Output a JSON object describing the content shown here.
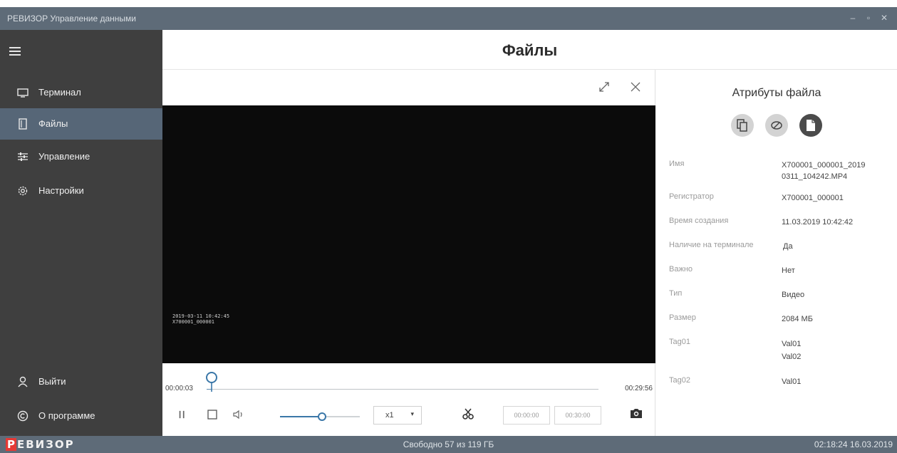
{
  "window": {
    "title": "РЕВИЗОР Управление данными",
    "minimize_icon": "minimize-icon",
    "maximize_icon": "maximize-icon",
    "close_icon": "close-icon"
  },
  "sidebar": {
    "items": [
      {
        "label": "Терминал",
        "icon": "monitor-icon"
      },
      {
        "label": "Файлы",
        "icon": "file-icon",
        "active": true
      },
      {
        "label": "Управление",
        "icon": "sliders-icon"
      },
      {
        "label": "Настройки",
        "icon": "gear-icon"
      }
    ],
    "bottom": [
      {
        "label": "Выйти",
        "icon": "user-icon"
      },
      {
        "label": "О программе",
        "icon": "copyright-icon"
      }
    ]
  },
  "header": {
    "title": "Файлы"
  },
  "player": {
    "osd_line1": "2019-03-11 10:42:45",
    "osd_line2": "X700001_000001",
    "time_current": "00:00:03",
    "time_total": "00:29:56",
    "progress_fraction": 0.013,
    "volume_fraction": 0.53,
    "speed": "x1",
    "trim_start": "00:00:00",
    "trim_end": "00:30:00"
  },
  "attributes": {
    "title": "Атрибуты файла",
    "rows": [
      {
        "key": "Имя",
        "value": "X700001_000001_2019\n0311_104242.MP4"
      },
      {
        "key": "Регистратор",
        "value": "X700001_000001"
      },
      {
        "key": "Время создания",
        "value": "11.03.2019 10:42:42"
      },
      {
        "key": "Наличие на терминале",
        "value": "Да"
      },
      {
        "key": "Важно",
        "value": "Нет"
      },
      {
        "key": "Тип",
        "value": "Видео"
      },
      {
        "key": "Размер",
        "value": "2084 МБ"
      },
      {
        "key": "Tag01",
        "value": "Val01\nVal02"
      },
      {
        "key": "Tag02",
        "value": "Val01"
      }
    ]
  },
  "status": {
    "logo_first": "Р",
    "logo_rest": "ЕВИЗОР",
    "free_space": "Свободно 57 из 119 ГБ",
    "clock": "02:18:24 16.03.2019"
  },
  "colors": {
    "titlebar": "#5e6b78",
    "sidebar": "#3f3f3f",
    "active_item": "#566677",
    "accent": "#3a77a8",
    "logo_red": "#e53935"
  }
}
